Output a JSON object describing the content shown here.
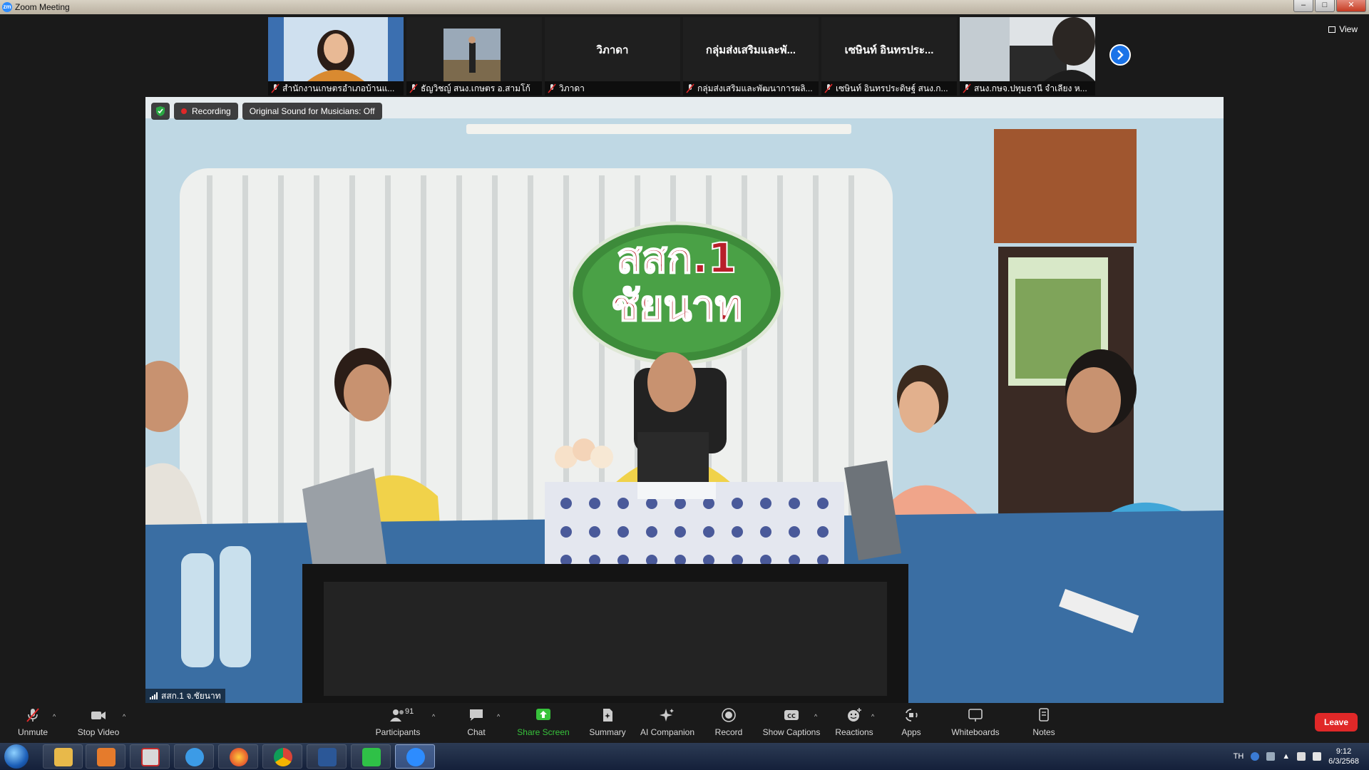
{
  "window": {
    "title": "Zoom Meeting"
  },
  "thumbnails": [
    {
      "label": "สำนักงานเกษตรอำเภอบ้านแ...",
      "big_name": "",
      "kind": "video-woman"
    },
    {
      "label": "ธัญวิชญ์ สนง.เกษตร อ.สามโก้",
      "big_name": "",
      "kind": "video-man-outdoor"
    },
    {
      "label": "วิภาดา",
      "big_name": "วิภาดา",
      "kind": "name"
    },
    {
      "label": "กลุ่มส่งเสริมและพัฒนาการผลิ...",
      "big_name": "กลุ่มส่งเสริมและพั...",
      "kind": "name"
    },
    {
      "label": "เซษินท์ อินทรประดิษฐ์ สนง.ก...",
      "big_name": "เซษินท์ อินทรประ...",
      "kind": "name"
    },
    {
      "label": "สนง.กษจ.ปทุมธานี จำเลียง ห...",
      "big_name": "",
      "kind": "video-man-office"
    }
  ],
  "view_button": {
    "label": "View"
  },
  "badges": {
    "recording": "Recording",
    "original_sound": "Original Sound for Musicians: Off"
  },
  "main_video": {
    "participant_label": "สสก.1 จ.ชัยนาท",
    "sign_line1": "สสก.1",
    "sign_line2": "ชัยนาท"
  },
  "toolbar": {
    "unmute": "Unmute",
    "stop_video": "Stop Video",
    "participants": "Participants",
    "participants_count": "91",
    "chat": "Chat",
    "share_screen": "Share Screen",
    "summary": "Summary",
    "ai_companion": "AI Companion",
    "record": "Record",
    "show_captions": "Show Captions",
    "reactions": "Reactions",
    "apps": "Apps",
    "whiteboards": "Whiteboards",
    "notes": "Notes",
    "leave": "Leave"
  },
  "taskbar": {
    "language": "TH",
    "time": "9:12",
    "date": "6/3/2568",
    "apps": [
      "file-explorer",
      "media-player",
      "acrobat",
      "internet-explorer",
      "firefox",
      "chrome",
      "word",
      "line",
      "zoom"
    ]
  }
}
